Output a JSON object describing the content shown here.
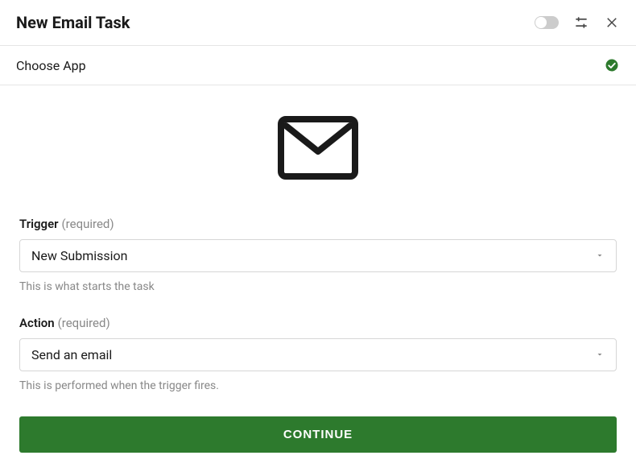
{
  "header": {
    "title": "New Email Task"
  },
  "section": {
    "title": "Choose App"
  },
  "trigger": {
    "label": "Trigger",
    "required": "(required)",
    "value": "New Submission",
    "help": "This is what starts the task"
  },
  "action": {
    "label": "Action",
    "required": "(required)",
    "value": "Send an email",
    "help": "This is performed when the trigger fires."
  },
  "continue_label": "CONTINUE"
}
